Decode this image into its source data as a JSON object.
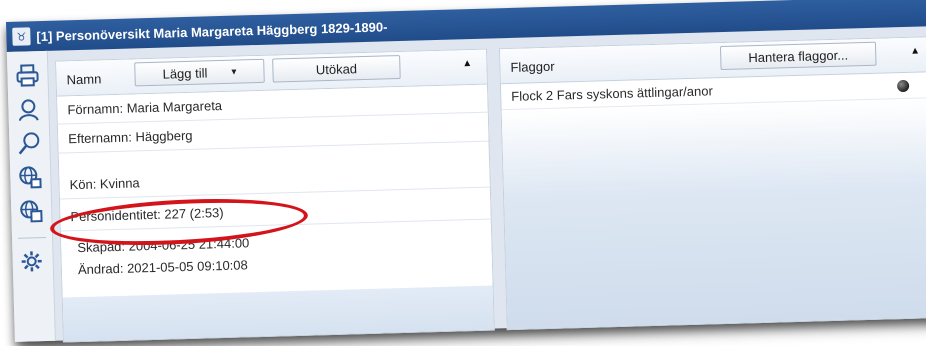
{
  "window": {
    "title": "[1] Personöversikt Maria Margareta Häggberg 1829-1890-",
    "app_icon_glyph": "♉"
  },
  "toolbar": {
    "icons": [
      "printer-icon",
      "person-search-icon",
      "search-icon",
      "globe-edit-icon",
      "globe-copy-icon",
      "settings-gear-icon"
    ]
  },
  "left_panel": {
    "header_label": "Namn",
    "add_button_label": "Lägg till",
    "add_button_caret": "▾",
    "extended_button_label": "Utökad",
    "collapse_caret": "▲",
    "rows": [
      "Förnamn: Maria Margareta",
      "Efternamn: Häggberg",
      "Kön: Kvinna",
      "Personidentitet: 227 (2:53)"
    ],
    "created": "Skapad:  2004-06-25  21:44:00",
    "modified": "Ändrad: 2021-05-05  09:10:08"
  },
  "right_panel": {
    "header_label": "Flaggor",
    "manage_button_label": "Hantera flaggor...",
    "collapse_caret": "▲",
    "flags": [
      {
        "label": "Flock 2 Fars syskons ättlingar/anor",
        "color": "#222222"
      }
    ]
  },
  "colors": {
    "title_bar": "#2b5797",
    "annotation_ellipse": "#d3141b"
  }
}
